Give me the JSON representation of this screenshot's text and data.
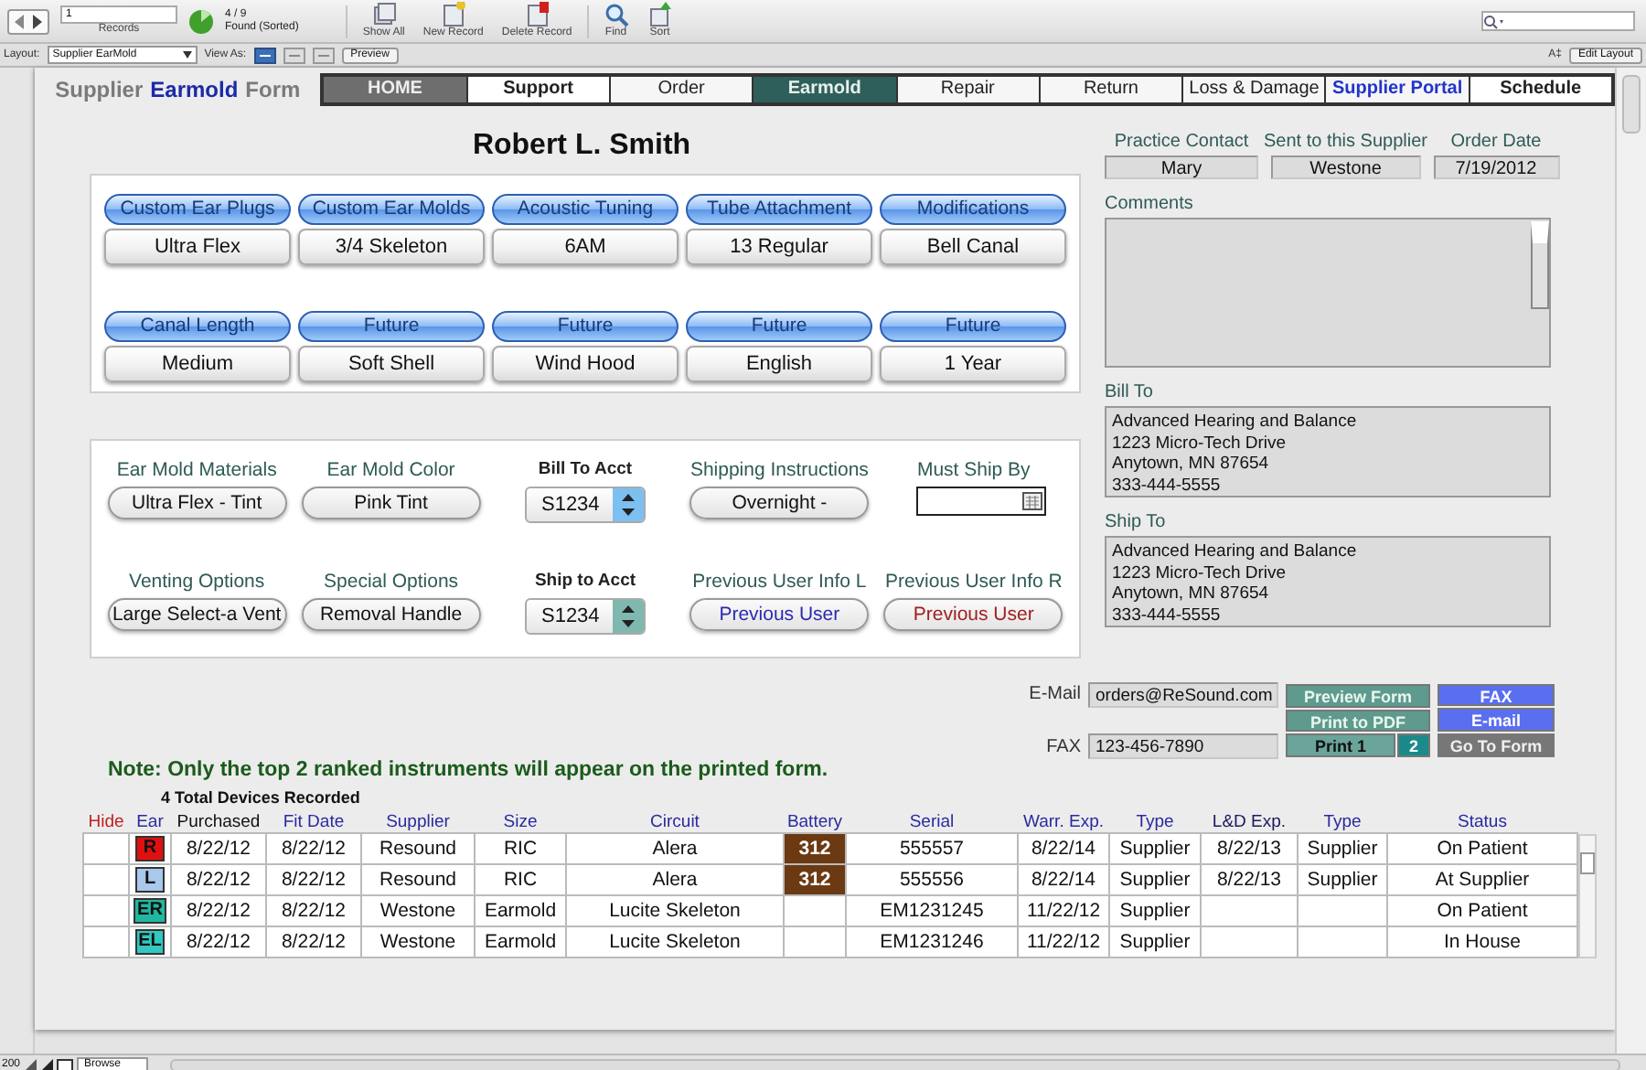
{
  "toolbar": {
    "record_number": "1",
    "records_label": "Records",
    "found": "4 / 9",
    "found_label": "Found (Sorted)",
    "actions": [
      {
        "kind": "show_all",
        "label": "Show All"
      },
      {
        "kind": "new",
        "label": "New Record"
      },
      {
        "kind": "delete",
        "label": "Delete Record"
      },
      {
        "kind": "find",
        "label": "Find"
      },
      {
        "kind": "sort",
        "label": "Sort"
      }
    ]
  },
  "layout_bar": {
    "layout_label": "Layout:",
    "layout": "Supplier EarMold",
    "view_as_label": "View As:",
    "view_modes": [
      {
        "selected": true
      },
      {
        "selected": false
      },
      {
        "selected": false
      }
    ],
    "preview": "Preview",
    "text_size": "A‡",
    "edit_layout": "Edit Layout"
  },
  "form_title": {
    "prefix": "Supplier",
    "highlight": "Earmold",
    "suffix": "Form"
  },
  "nav_tabs": [
    {
      "label": "HOME",
      "kind": "home",
      "selected": false
    },
    {
      "label": "Support",
      "kind": "bold",
      "selected": false
    },
    {
      "label": "Order",
      "kind": "plain",
      "selected": false
    },
    {
      "label": "Earmold",
      "kind": "plain",
      "selected": true
    },
    {
      "label": "Repair",
      "kind": "plain",
      "selected": false
    },
    {
      "label": "Return",
      "kind": "plain",
      "selected": false
    },
    {
      "label": "Loss & Damage",
      "kind": "plain",
      "selected": false
    },
    {
      "label": "Supplier Portal",
      "kind": "portal",
      "selected": false
    },
    {
      "label": "Schedule",
      "kind": "bold",
      "selected": false
    }
  ],
  "patient_name": "Robert L. Smith",
  "options": [
    {
      "label": "Custom Ear Plugs",
      "value": "Ultra Flex"
    },
    {
      "label": "Custom Ear Molds",
      "value": "3/4 Skeleton"
    },
    {
      "label": "Acoustic Tuning",
      "value": "6AM"
    },
    {
      "label": "Tube Attachment",
      "value": "13 Regular"
    },
    {
      "label": "Modifications",
      "value": "Bell Canal"
    },
    {
      "label": "Canal Length",
      "value": "Medium"
    },
    {
      "label": "Future",
      "value": "Soft Shell"
    },
    {
      "label": "Future",
      "value": "Wind Hood"
    },
    {
      "label": "Future",
      "value": "English"
    },
    {
      "label": "Future",
      "value": "1 Year"
    }
  ],
  "order_fields": [
    {
      "kind": "pill",
      "label": "Ear Mold Materials",
      "value": "Ultra Flex - Tint"
    },
    {
      "kind": "pill",
      "label": "Ear Mold Color",
      "value": "Pink Tint"
    },
    {
      "kind": "select",
      "label": "Bill To Acct",
      "value": "S1234",
      "color": "#7cc0f2"
    },
    {
      "kind": "pill",
      "label": "Shipping Instructions",
      "value": "Overnight -"
    },
    {
      "kind": "date",
      "label": "Must Ship By"
    },
    {
      "kind": "pill",
      "label": "Venting Options",
      "value": "Large Select-a Vent"
    },
    {
      "kind": "pill",
      "label": "Special Options",
      "value": "Removal Handle"
    },
    {
      "kind": "select",
      "label": "Ship to Acct",
      "value": "S1234",
      "color": "#7fb8ae"
    },
    {
      "kind": "pill",
      "label": "Previous User Info L",
      "value": "Previous User",
      "color": "#2a2ab0"
    },
    {
      "kind": "pill",
      "label": "Previous User Info R",
      "value": "Previous User",
      "color": "#a02020"
    }
  ],
  "contacts": [
    {
      "label": "Practice Contact",
      "value": "Mary"
    },
    {
      "label": "Sent to this Supplier",
      "value": "Westone"
    },
    {
      "label": "Order Date",
      "value": "7/19/2012"
    }
  ],
  "comments_label": "Comments",
  "bill_to": {
    "label": "Bill To",
    "lines": [
      "Advanced Hearing and Balance",
      "1223 Micro-Tech Drive",
      "Anytown, MN 87654",
      "333-444-5555"
    ]
  },
  "ship_to": {
    "label": "Ship To",
    "lines": [
      "Advanced Hearing and Balance",
      "1223 Micro-Tech Drive",
      "Anytown, MN 87654",
      "333-444-5555"
    ]
  },
  "email": {
    "label": "E-Mail",
    "value": "orders@ReSound.com"
  },
  "fax": {
    "label": "FAX",
    "value": "123-456-7890"
  },
  "form_buttons": [
    {
      "label": "Preview Form",
      "kind": "green"
    },
    {
      "label": "FAX",
      "kind": "blue"
    },
    {
      "label": "Print to PDF",
      "kind": "green"
    },
    {
      "label": "E-mail",
      "kind": "blue"
    },
    {
      "label": "Print 1",
      "kind": "print"
    },
    {
      "label": "2",
      "kind": "teal"
    },
    {
      "label": "Go To Form",
      "kind": "grey"
    }
  ],
  "note": "Note: Only the top 2 ranked instruments will appear on the printed form.",
  "devices": {
    "count": "4 Total Devices Recorded",
    "columns": [
      {
        "label": "Hide",
        "kind": "hide",
        "color": "#c02020"
      },
      {
        "label": "Ear",
        "kind": "ear",
        "color": "#2a2aa0"
      },
      {
        "label": "Purchased",
        "kind": "text",
        "color": "#111111"
      },
      {
        "label": "Fit Date",
        "kind": "text",
        "color": "#2a2aa0"
      },
      {
        "label": "Supplier",
        "kind": "text",
        "color": "#2a2aa0"
      },
      {
        "label": "Size",
        "kind": "text",
        "color": "#2a2aa0"
      },
      {
        "label": "Circuit",
        "kind": "wide",
        "color": "#2a2aa0"
      },
      {
        "label": "Battery",
        "kind": "battery",
        "color": "#2a2aa0"
      },
      {
        "label": "Serial",
        "kind": "text",
        "color": "#2a2aa0"
      },
      {
        "label": "Warr. Exp.",
        "kind": "text",
        "color": "#2a2aa0"
      },
      {
        "label": "Type",
        "kind": "text",
        "color": "#2a2aa0"
      },
      {
        "label": "L&D  Exp.",
        "kind": "text",
        "color": "#1a1a60"
      },
      {
        "label": "Type",
        "kind": "text",
        "color": "#2a2aa0"
      },
      {
        "label": "Status",
        "kind": "wide",
        "color": "#2a2aa0"
      }
    ],
    "rows": [
      {
        "color": "#e01010",
        "cells": [
          "",
          "R",
          "8/22/12",
          "8/22/12",
          "Resound",
          "RIC",
          "Alera",
          "312",
          "555557",
          "8/22/14",
          "Supplier",
          "8/22/13",
          "Supplier",
          "On Patient"
        ]
      },
      {
        "color": "#a8c8ec",
        "cells": [
          "",
          "L",
          "8/22/12",
          "8/22/12",
          "Resound",
          "RIC",
          "Alera",
          "312",
          "555556",
          "8/22/14",
          "Supplier",
          "8/22/13",
          "Supplier",
          "At Supplier"
        ]
      },
      {
        "color": "#1fb8a0",
        "cells": [
          "",
          "ER",
          "8/22/12",
          "8/22/12",
          "Westone",
          "Earmold",
          "Lucite Skeleton",
          "",
          "EM1231245",
          "11/22/12",
          "Supplier",
          "",
          "",
          "On Patient"
        ]
      },
      {
        "color": "#30c8c0",
        "cells": [
          "",
          "EL",
          "8/22/12",
          "8/22/12",
          "Westone",
          "Earmold",
          "Lucite Skeleton",
          "",
          "EM1231246",
          "11/22/12",
          "Supplier",
          "",
          "",
          "In House"
        ]
      }
    ]
  },
  "status_bar": {
    "zoom": "200",
    "mode": "Browse"
  }
}
